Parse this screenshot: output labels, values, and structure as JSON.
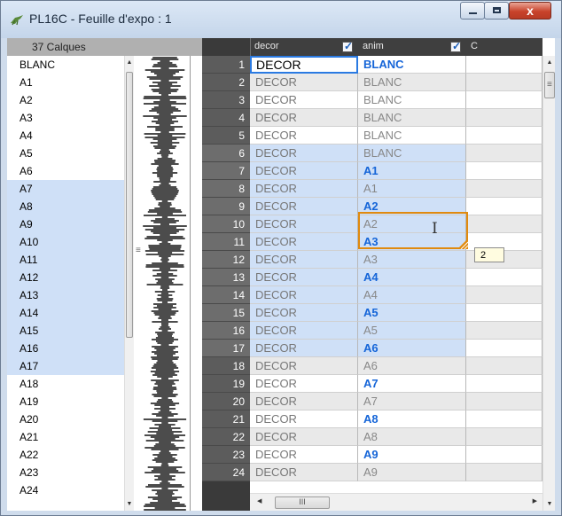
{
  "window": {
    "title": "PL16C - Feuille d'expo : 1",
    "buttons": {
      "minimize": "–",
      "maximize": "□",
      "close": "x"
    },
    "title_icon": "grasshopper-app-icon"
  },
  "layers_panel": {
    "header": "37  Calques",
    "items": [
      {
        "label": "BLANC",
        "selected": false
      },
      {
        "label": "A1",
        "selected": false
      },
      {
        "label": "A2",
        "selected": false
      },
      {
        "label": "A3",
        "selected": false
      },
      {
        "label": "A4",
        "selected": false
      },
      {
        "label": "A5",
        "selected": false
      },
      {
        "label": "A6",
        "selected": false
      },
      {
        "label": "A7",
        "selected": true
      },
      {
        "label": "A8",
        "selected": true
      },
      {
        "label": "A9",
        "selected": true
      },
      {
        "label": "A10",
        "selected": true
      },
      {
        "label": "A11",
        "selected": true
      },
      {
        "label": "A12",
        "selected": true
      },
      {
        "label": "A13",
        "selected": true
      },
      {
        "label": "A14",
        "selected": true
      },
      {
        "label": "A15",
        "selected": true
      },
      {
        "label": "A16",
        "selected": true
      },
      {
        "label": "A17",
        "selected": true
      },
      {
        "label": "A18",
        "selected": false
      },
      {
        "label": "A19",
        "selected": false
      },
      {
        "label": "A20",
        "selected": false
      },
      {
        "label": "A21",
        "selected": false
      },
      {
        "label": "A22",
        "selected": false
      },
      {
        "label": "A23",
        "selected": false
      },
      {
        "label": "A24",
        "selected": false
      }
    ]
  },
  "sheet": {
    "columns": [
      {
        "label": "decor",
        "checked": true
      },
      {
        "label": "anim",
        "checked": true
      },
      {
        "label": "C",
        "checked": false
      }
    ],
    "rows": [
      {
        "n": "1",
        "decor": "DECOR",
        "anim": "BLANC",
        "key": true
      },
      {
        "n": "2",
        "decor": "DECOR",
        "anim": "BLANC",
        "key": false
      },
      {
        "n": "3",
        "decor": "DECOR",
        "anim": "BLANC",
        "key": false
      },
      {
        "n": "4",
        "decor": "DECOR",
        "anim": "BLANC",
        "key": false
      },
      {
        "n": "5",
        "decor": "DECOR",
        "anim": "BLANC",
        "key": false
      },
      {
        "n": "6",
        "decor": "DECOR",
        "anim": "BLANC",
        "key": false
      },
      {
        "n": "7",
        "decor": "DECOR",
        "anim": "A1",
        "key": true
      },
      {
        "n": "8",
        "decor": "DECOR",
        "anim": "A1",
        "key": false
      },
      {
        "n": "9",
        "decor": "DECOR",
        "anim": "A2",
        "key": true
      },
      {
        "n": "10",
        "decor": "DECOR",
        "anim": "A2",
        "key": false
      },
      {
        "n": "11",
        "decor": "DECOR",
        "anim": "A3",
        "key": true
      },
      {
        "n": "12",
        "decor": "DECOR",
        "anim": "A3",
        "key": false
      },
      {
        "n": "13",
        "decor": "DECOR",
        "anim": "A4",
        "key": true
      },
      {
        "n": "14",
        "decor": "DECOR",
        "anim": "A4",
        "key": false
      },
      {
        "n": "15",
        "decor": "DECOR",
        "anim": "A5",
        "key": true
      },
      {
        "n": "16",
        "decor": "DECOR",
        "anim": "A5",
        "key": false
      },
      {
        "n": "17",
        "decor": "DECOR",
        "anim": "A6",
        "key": true
      },
      {
        "n": "18",
        "decor": "DECOR",
        "anim": "A6",
        "key": false
      },
      {
        "n": "19",
        "decor": "DECOR",
        "anim": "A7",
        "key": true
      },
      {
        "n": "20",
        "decor": "DECOR",
        "anim": "A7",
        "key": false
      },
      {
        "n": "21",
        "decor": "DECOR",
        "anim": "A8",
        "key": true
      },
      {
        "n": "22",
        "decor": "DECOR",
        "anim": "A8",
        "key": false
      },
      {
        "n": "23",
        "decor": "DECOR",
        "anim": "A9",
        "key": true
      },
      {
        "n": "24",
        "decor": "DECOR",
        "anim": "A9",
        "key": false
      }
    ],
    "active_cell": {
      "row": "1",
      "column": "decor"
    },
    "tooltip": "2",
    "scroll_grip": "III"
  },
  "colors": {
    "key_text": "#1565d8",
    "selection_fill": "#cfe0f7",
    "selection_border": "#e08a0e",
    "active_border": "#2a7ae2"
  }
}
